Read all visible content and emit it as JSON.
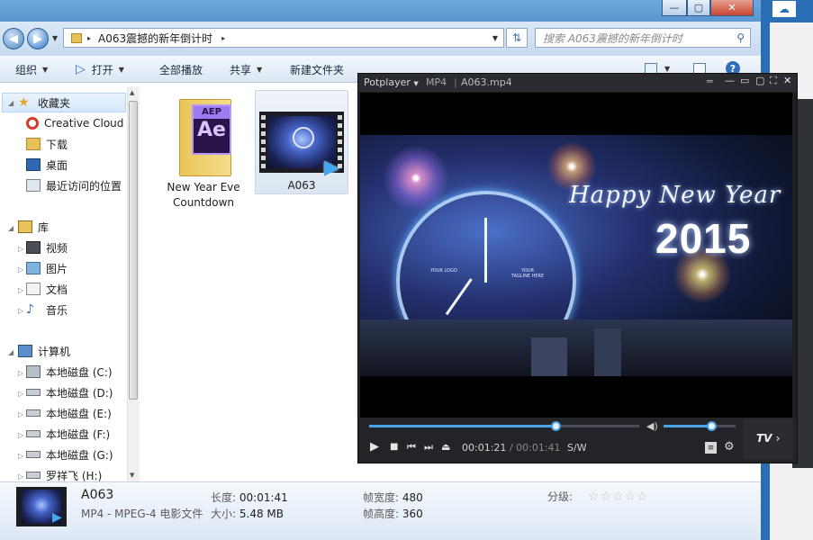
{
  "explorer": {
    "window_controls": {
      "minimize": "—",
      "maximize": "▢",
      "close": "✕"
    },
    "address": {
      "path_root_sep": "▸",
      "folder": "A063震撼的新年倒计时",
      "path_end_sep": "▸"
    },
    "search": {
      "placeholder": "搜索 A063震撼的新年倒计时"
    },
    "toolbar": {
      "organize": "组织",
      "open": "打开",
      "play_all": "全部播放",
      "share": "共享",
      "new_folder": "新建文件夹"
    },
    "nav": {
      "favorites": {
        "label": "收藏夹",
        "items": [
          "Creative Cloud",
          "下载",
          "桌面",
          "最近访问的位置"
        ]
      },
      "libraries": {
        "label": "库",
        "items": [
          "视频",
          "图片",
          "文档",
          "音乐"
        ]
      },
      "computer": {
        "label": "计算机",
        "items": [
          "本地磁盘 (C:)",
          "本地磁盘 (D:)",
          "本地磁盘 (E:)",
          "本地磁盘 (F:)",
          "本地磁盘 (G:)",
          "罗祥飞 (H:)"
        ]
      }
    },
    "files": [
      {
        "name_line1": "New Year Eve",
        "name_line2": "Countdown",
        "icon": "folder-ae-icon",
        "badge1": "AEP",
        "badge2": "Ae"
      },
      {
        "name": "A063",
        "icon": "video-thumbnail"
      }
    ],
    "details": {
      "name": "A063",
      "type": "MP4 - MPEG-4 电影文件",
      "length_label": "长度:",
      "length": "00:01:41",
      "size_label": "大小:",
      "size": "5.48 MB",
      "width_label": "帧宽度:",
      "width": "480",
      "height_label": "帧高度:",
      "height": "360",
      "rating_label": "分级:",
      "rating_stars": 0
    }
  },
  "player": {
    "app": "Potplayer",
    "format": "MP4",
    "filename": "A063.mp4",
    "video_text": {
      "greeting": "Happy New Year",
      "year": "2015",
      "tagline1": "YOUR",
      "tagline2": "TAGLINE HERE",
      "logo": "YOUR LOGO"
    },
    "time_current": "00:01:21",
    "time_sep": "/",
    "time_total": "00:01:41",
    "mode": "S/W",
    "progress": 0.69,
    "volume": 0.66,
    "tv_label": "TV"
  },
  "colors": {
    "accent": "#4aa3e6",
    "titlebar": "#5b95cf",
    "player_bg": "#1d1f23"
  }
}
